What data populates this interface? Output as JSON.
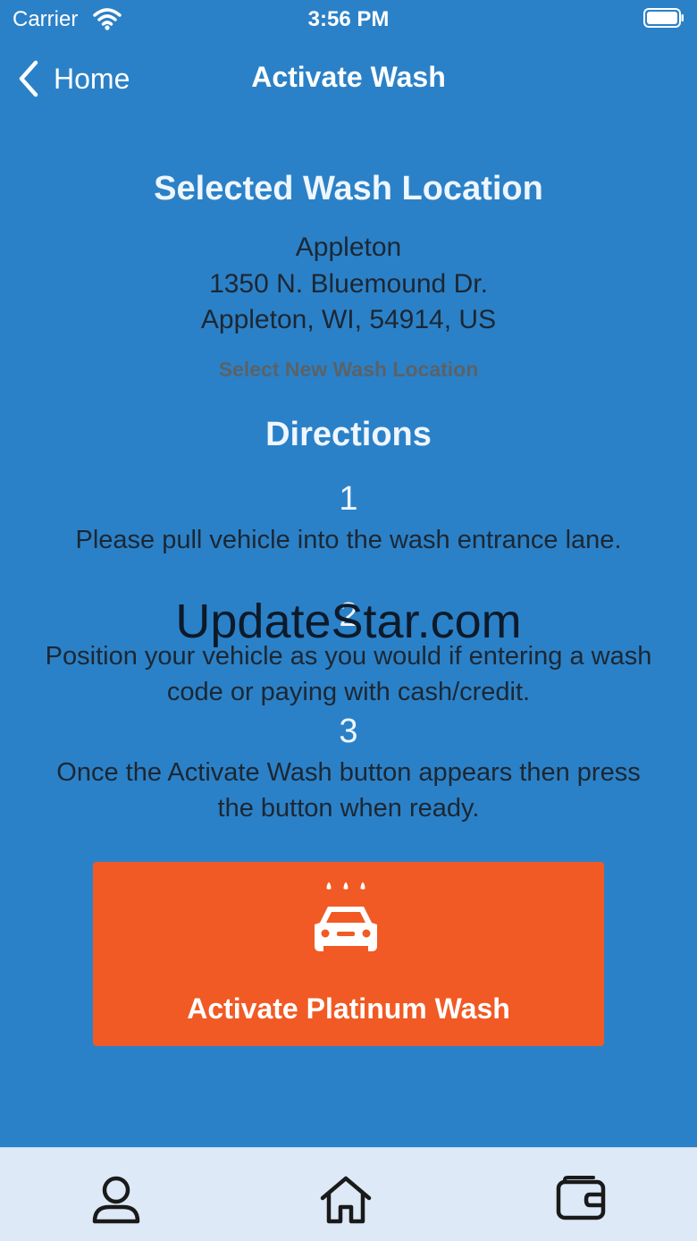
{
  "status_bar": {
    "carrier": "Carrier",
    "time": "3:56 PM"
  },
  "nav": {
    "back_label": "Home",
    "title": "Activate Wash"
  },
  "location": {
    "heading": "Selected Wash Location",
    "name": "Appleton",
    "street": "1350 N. Bluemound Dr.",
    "city_line": "Appleton, WI, 54914, US",
    "select_new_label": "Select New Wash Location"
  },
  "directions": {
    "heading": "Directions",
    "steps": [
      {
        "number": "1",
        "text": "Please pull vehicle into the wash entrance lane."
      },
      {
        "number": "2",
        "text": "Position your vehicle as you would if entering a wash code or paying with cash/credit."
      },
      {
        "number": "3",
        "text": "Once the Activate Wash button appears then press the button when ready."
      }
    ]
  },
  "watermark": "UpdateStar.com",
  "activate": {
    "label": "Activate Platinum Wash",
    "icon": "car-wash-icon",
    "color": "#f15a24"
  },
  "tab_bar": {
    "items": [
      "person-icon",
      "home-icon",
      "wallet-icon"
    ]
  },
  "colors": {
    "background": "#2b81c7",
    "tab_bar": "#dde9f6"
  }
}
